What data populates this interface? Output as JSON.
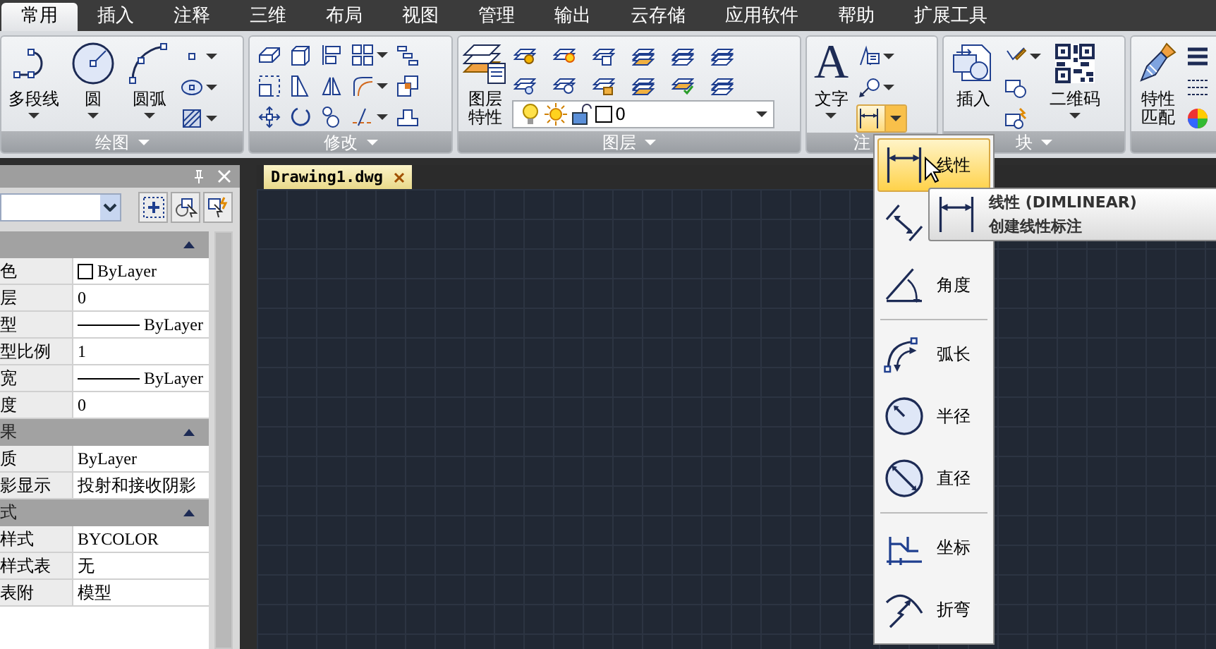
{
  "tabs": [
    {
      "label": "常用",
      "selected": true
    },
    {
      "label": "插入",
      "selected": false
    },
    {
      "label": "注释",
      "selected": false
    },
    {
      "label": "三维",
      "selected": false
    },
    {
      "label": "布局",
      "selected": false
    },
    {
      "label": "视图",
      "selected": false
    },
    {
      "label": "管理",
      "selected": false
    },
    {
      "label": "输出",
      "selected": false
    },
    {
      "label": "云存储",
      "selected": false
    },
    {
      "label": "应用软件",
      "selected": false
    },
    {
      "label": "帮助",
      "selected": false
    },
    {
      "label": "扩展工具",
      "selected": false
    }
  ],
  "ribbon": {
    "panels": [
      {
        "kind": "draw",
        "title": "绘图",
        "big_buttons": [
          {
            "kind": "polyline",
            "label": "多段线"
          },
          {
            "kind": "circle",
            "label": "圆"
          },
          {
            "kind": "arc",
            "label": "圆弧"
          }
        ]
      },
      {
        "kind": "modify",
        "title": "修改"
      },
      {
        "kind": "layer",
        "title": "图层",
        "big_buttons": [
          {
            "kind": "layers",
            "label": "图层特性"
          }
        ],
        "layer_value": "0"
      },
      {
        "kind": "annotate",
        "title": "注",
        "big_buttons": [
          {
            "label": "文字",
            "glyph": "A"
          }
        ],
        "dimension_expanded": true
      },
      {
        "kind": "block",
        "title": "块",
        "big_buttons": [
          {
            "kind": "insert",
            "label": "插入"
          },
          {
            "kind": "qr",
            "label": "二维码"
          }
        ]
      },
      {
        "kind": "match",
        "big_buttons": [
          {
            "kind": "brush",
            "label": "特性匹配"
          }
        ]
      }
    ]
  },
  "properties": {
    "sections": [
      {
        "expanded": true,
        "rows": [
          {
            "label": "色",
            "value": "ByLayer",
            "kind": "color"
          },
          {
            "label": "层",
            "value": "0",
            "kind": "text"
          },
          {
            "label": "型",
            "value": "ByLayer",
            "kind": "line"
          },
          {
            "label": "型比例",
            "value": "1",
            "kind": "text"
          },
          {
            "label": "宽",
            "value": "ByLayer",
            "kind": "line"
          },
          {
            "label": "度",
            "value": "0",
            "kind": "text"
          }
        ]
      },
      {
        "title": "果",
        "expanded": true,
        "rows": [
          {
            "label": "质",
            "value": "ByLayer",
            "kind": "text"
          },
          {
            "label": "影显示",
            "value": "投射和接收阴影",
            "kind": "text"
          }
        ]
      },
      {
        "title": "式",
        "expanded": true,
        "rows": [
          {
            "label": "样式",
            "value": "BYCOLOR",
            "kind": "text"
          },
          {
            "label": "样式表",
            "value": "无",
            "kind": "text"
          },
          {
            "label": "表附",
            "value": "模型",
            "kind": "text"
          }
        ]
      }
    ]
  },
  "document_tab": {
    "label": "Drawing1.dwg",
    "selected": true
  },
  "dimension_menu": {
    "groups": [
      [
        {
          "kind": "linear",
          "label": "线性",
          "selected": true
        },
        {
          "kind": "aligned",
          "selected": false
        },
        {
          "kind": "angular",
          "label": "角度",
          "selected": false
        }
      ],
      [
        {
          "kind": "arc",
          "label": "弧长",
          "selected": false
        },
        {
          "kind": "radius",
          "label": "半径",
          "selected": false
        },
        {
          "kind": "diameter",
          "label": "直径",
          "selected": false
        }
      ],
      [
        {
          "kind": "ordinate",
          "label": "坐标",
          "selected": false
        },
        {
          "kind": "jog",
          "label": "折弯",
          "selected": false
        }
      ]
    ]
  },
  "tooltip": {
    "title": "线性 (DIMLINEAR)",
    "description": "创建线性标注"
  }
}
